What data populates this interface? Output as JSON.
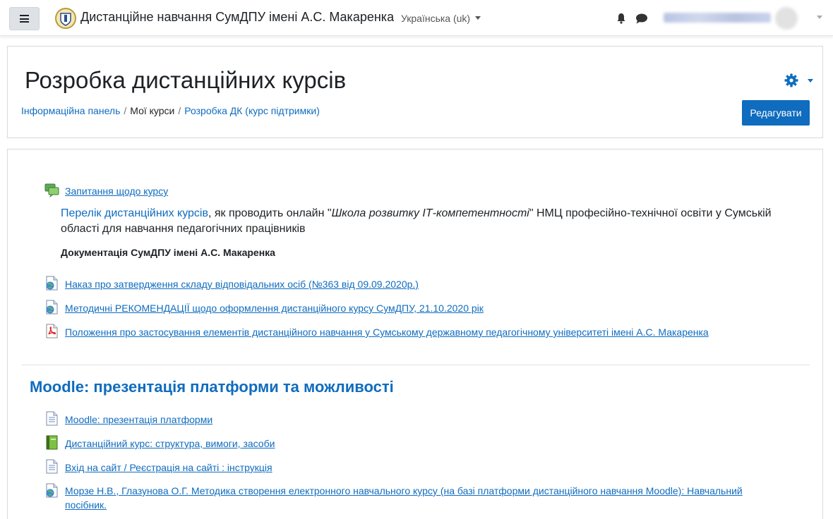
{
  "navbar": {
    "site_name": "Дистанційне навчання СумДПУ імені А.С. Макаренка",
    "language": "Українська (uk)"
  },
  "header": {
    "title": "Розробка дистанційних курсів",
    "breadcrumb": [
      "Інформаційна панель",
      "Мої курси",
      "Розробка ДК (курс підтримки)"
    ],
    "edit_button": "Редагувати"
  },
  "section0": {
    "forum_link": "Запитання щодо курсу",
    "intro_link": "Перелік дистанційних курсів",
    "intro_text1": ", як проводить онлайн \"",
    "intro_italic": "Школа розвитку ІТ-компетентності",
    "intro_text2": "\" НМЦ професійно-технічної освіти у Сумській області для навчання  педагогічних працівників",
    "doc_heading": "Документація СумДПУ імені А.С. Макаренка",
    "activities": [
      {
        "label": "Наказ про затвердження складу відповідальних осіб (№363 від 09.09.2020р.)",
        "icon": "url-icon"
      },
      {
        "label": "Методичні РЕКОМЕНДАЦІЇ щодо оформлення дистанційного курсу СумДПУ, 21.10.2020 рік",
        "icon": "url-icon"
      },
      {
        "label": "Положення про застосування елементів дистанційного навчання у Сумському державному педагогічному університеті імені А.С. Макаренка",
        "icon": "pdf-icon"
      }
    ]
  },
  "section1": {
    "title": "Moodle: презентація платформи та можливості",
    "activities": [
      {
        "label": "Moodle: презентація платформи",
        "icon": "page-icon"
      },
      {
        "label": "Дистанційний курс: структура, вимоги, засоби",
        "icon": "book-icon"
      },
      {
        "label": "Вхід на сайт / Реєстрація на сайті : інструкція",
        "icon": "page-icon"
      },
      {
        "label": "Морзе Н.В., Глазунова О.Г. Методика створення електронного навчального курсу (на базі платформи дистанційного навчання Moodle): Навчальний посібник.",
        "icon": "url-icon"
      }
    ]
  },
  "colors": {
    "link": "#0f6cbf",
    "primary_button": "#0f6cbf",
    "text": "#1d2125"
  }
}
